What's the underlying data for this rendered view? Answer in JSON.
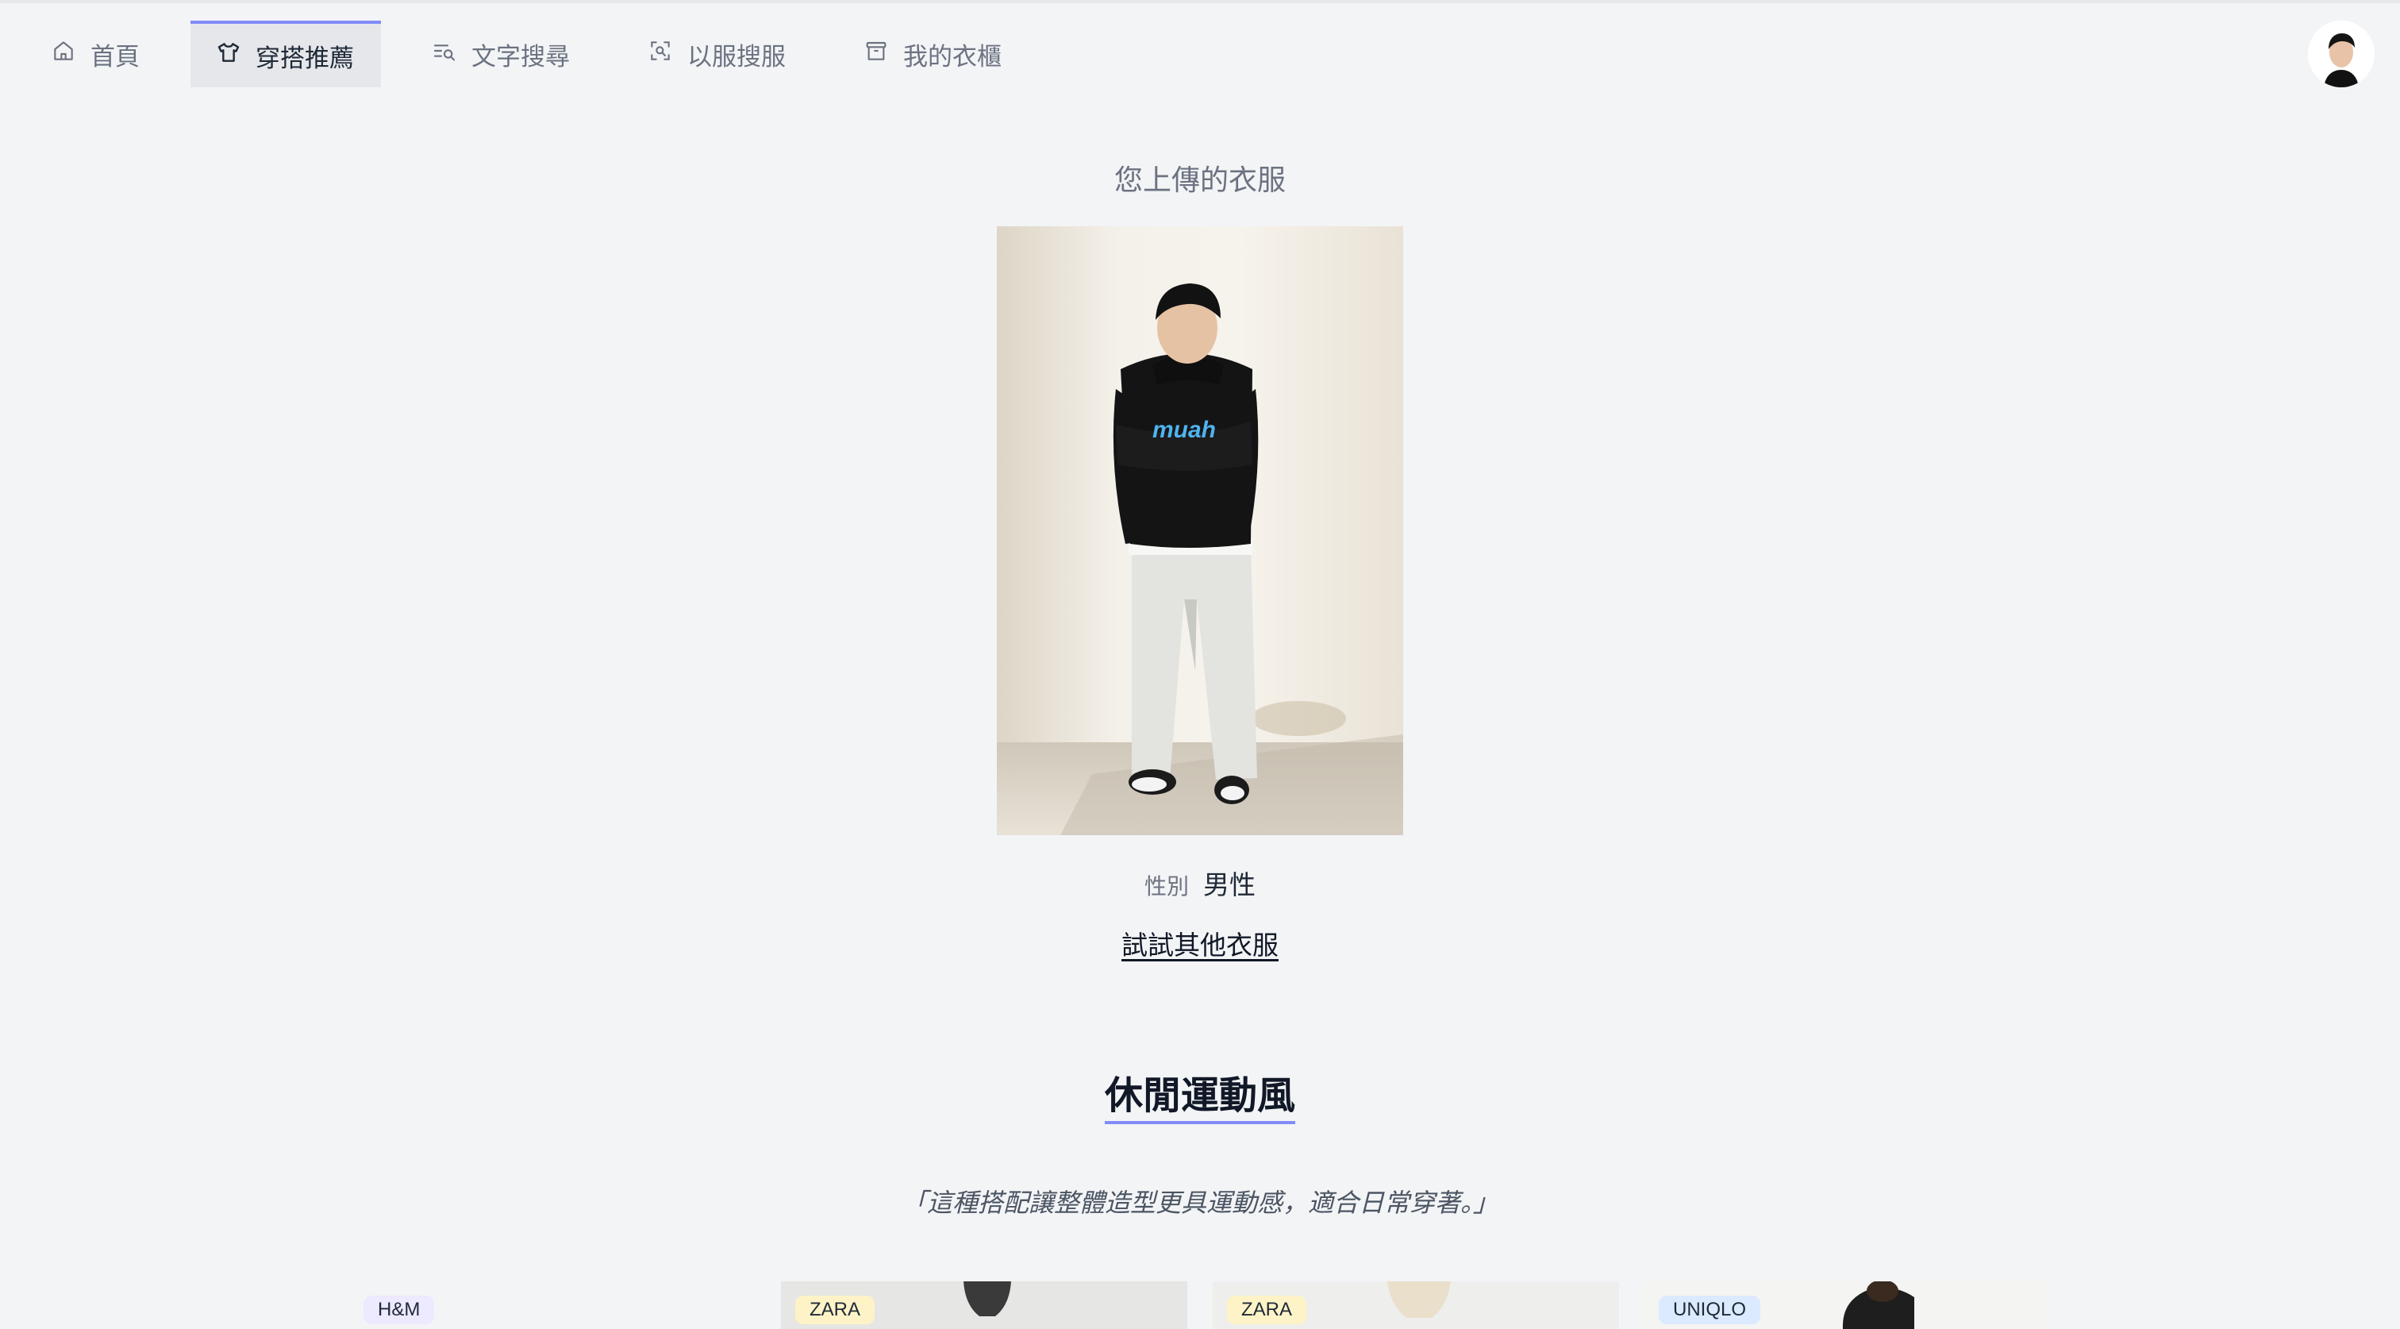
{
  "nav": {
    "items": [
      {
        "label": "首頁",
        "icon": "home-icon"
      },
      {
        "label": "穿搭推薦",
        "icon": "tshirt-icon"
      },
      {
        "label": "文字搜尋",
        "icon": "text-search-icon"
      },
      {
        "label": "以服搜服",
        "icon": "image-scan-icon"
      },
      {
        "label": "我的衣櫃",
        "icon": "wardrobe-icon"
      }
    ],
    "active_index": 1
  },
  "upload": {
    "title": "您上傳的衣服",
    "gender_label": "性別",
    "gender_value": "男性",
    "try_other": "試試其他衣服"
  },
  "style": {
    "title": "休閒運動風",
    "quote": "「這種搭配讓整體造型更具運動感，適合日常穿著。」"
  },
  "products": [
    {
      "brand": "H&M",
      "badge_color": "#ede9fe"
    },
    {
      "brand": "ZARA",
      "badge_color": "#fef3c7"
    },
    {
      "brand": "ZARA",
      "badge_color": "#fef3c7"
    },
    {
      "brand": "UNIQLO",
      "badge_color": "#dbeafe"
    }
  ],
  "colors": {
    "accent": "#818cf8",
    "background": "#f3f4f6"
  }
}
